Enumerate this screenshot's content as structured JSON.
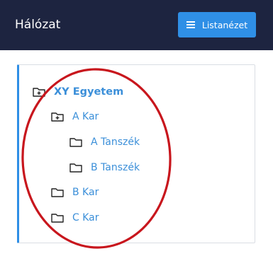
{
  "header": {
    "title": "Hálózat",
    "list_button_label": "Listanézet"
  },
  "tree": {
    "root": {
      "label": "XY Egyetem",
      "icon": "folder-plus-icon"
    },
    "faculty_a": {
      "label": "A Kar",
      "icon": "folder-plus-icon"
    },
    "dept_a": {
      "label": "A Tanszék",
      "icon": "folder-icon"
    },
    "dept_b": {
      "label": "B Tanszék",
      "icon": "folder-icon"
    },
    "faculty_b": {
      "label": "B Kar",
      "icon": "folder-icon"
    },
    "faculty_c": {
      "label": "C Kar",
      "icon": "folder-icon"
    }
  },
  "colors": {
    "header_bg": "#1d2440",
    "accent": "#2f8fe6",
    "link": "#3b8fd9",
    "annotation": "#c8161d"
  }
}
